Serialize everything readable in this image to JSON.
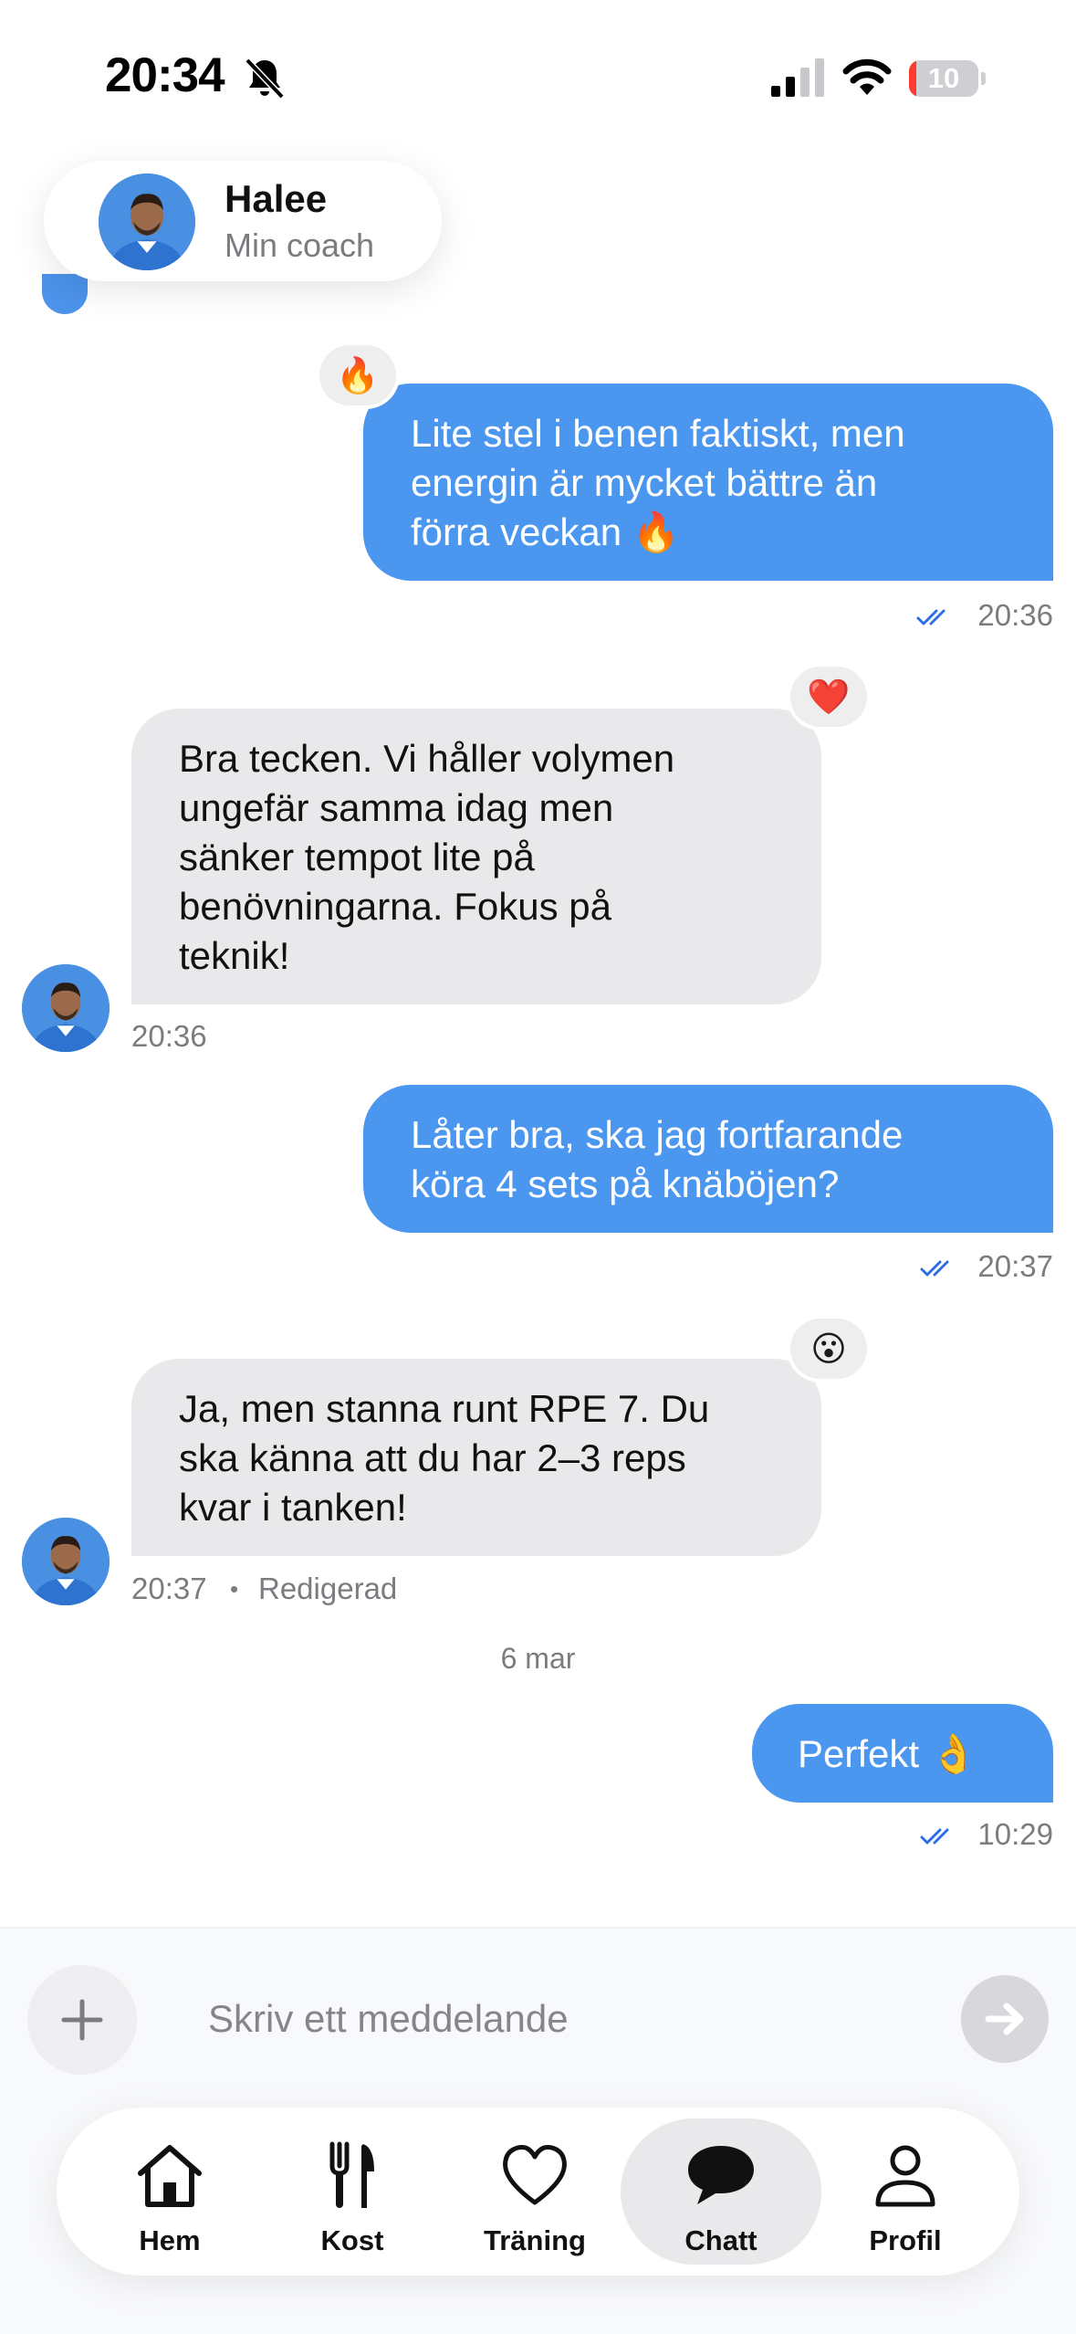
{
  "status_bar": {
    "time": "20:34",
    "battery": "10",
    "battery_level_percent": 10
  },
  "header": {
    "coach_name": "Halee",
    "coach_role": "Min coach"
  },
  "messages": [
    {
      "sender": "user",
      "lines": [
        "Lite stel i benen faktiskt, men",
        "energin är mycket bättre än",
        "förra veckan 🔥"
      ],
      "time": "20:36",
      "read": true,
      "reaction": "🔥"
    },
    {
      "sender": "coach",
      "lines": [
        "Bra tecken. Vi håller volymen",
        "ungefär samma idag men",
        "sänker tempot lite på",
        "benövningarna. Fokus på",
        "teknik!"
      ],
      "time": "20:36",
      "reaction": "❤️"
    },
    {
      "sender": "user",
      "lines": [
        "Låter bra, ska jag fortfarande",
        "köra 4 sets på knäböjen?"
      ],
      "time": "20:37",
      "read": true
    },
    {
      "sender": "coach",
      "lines": [
        "Ja, men stanna runt RPE 7. Du",
        "ska känna att du har 2–3 reps",
        "kvar i tanken!"
      ],
      "time": "20:37",
      "edited": "Redigerad",
      "reaction": "😮"
    },
    {
      "sender": "user",
      "lines": [
        "Perfekt 👌"
      ],
      "time": "10:29",
      "read": true
    }
  ],
  "date_separator": "6 mar",
  "composer": {
    "placeholder": "Skriv ett meddelande"
  },
  "tabs": [
    {
      "label": "Hem",
      "icon": "house-icon"
    },
    {
      "label": "Kost",
      "icon": "fork-knife-icon"
    },
    {
      "label": "Träning",
      "icon": "heart-icon"
    },
    {
      "label": "Chatt",
      "icon": "chat-bubble-icon",
      "active": true
    },
    {
      "label": "Profil",
      "icon": "person-icon"
    }
  ],
  "colors": {
    "accent": "#4b97ef",
    "received_bubble": "#e9e9eb",
    "read_ticks": "#2f6fe4",
    "battery_low": "#ff3b30"
  }
}
